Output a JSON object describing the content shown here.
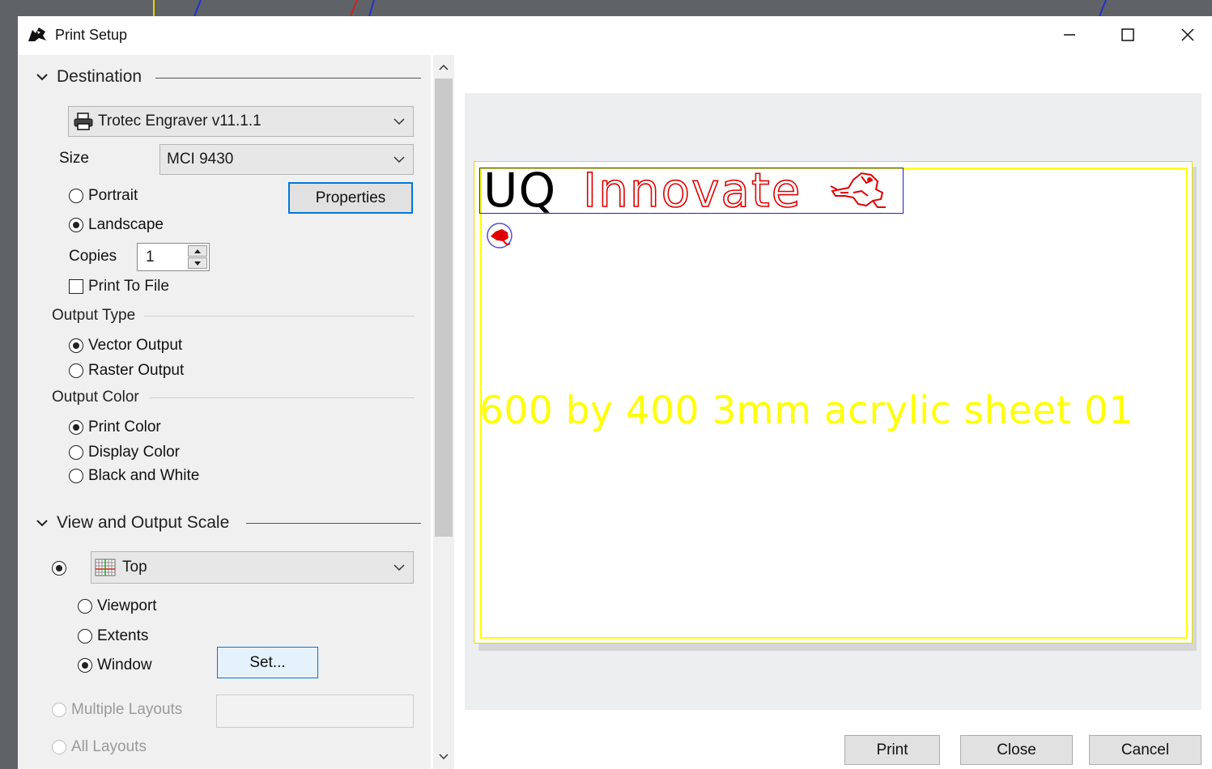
{
  "window": {
    "title": "Print Setup"
  },
  "destination": {
    "heading": "Destination",
    "printer": "Trotec Engraver v11.1.1",
    "size_label": "Size",
    "size_value": "MCI 9430",
    "orientation_portrait": "Portrait",
    "orientation_landscape": "Landscape",
    "selected_orientation": "Landscape",
    "properties_button": "Properties",
    "copies_label": "Copies",
    "copies_value": "1",
    "print_to_file": "Print To File",
    "print_to_file_checked": false
  },
  "output_type": {
    "heading": "Output Type",
    "vector": "Vector Output",
    "raster": "Raster Output",
    "selected": "Vector Output"
  },
  "output_color": {
    "heading": "Output Color",
    "print_color": "Print Color",
    "display_color": "Display Color",
    "black_white": "Black and White",
    "selected": "Print Color"
  },
  "view_scale": {
    "heading": "View and Output Scale",
    "view_value": "Top",
    "viewport": "Viewport",
    "extents": "Extents",
    "window": "Window",
    "selected_area": "Window",
    "set_button": "Set...",
    "multiple_layouts": "Multiple Layouts",
    "all_layouts": "All Layouts"
  },
  "preview": {
    "logo_uq": "UQ",
    "logo_innovate": "Innovate",
    "sheet_text": "600 by 400 3mm acrylic sheet 01",
    "colors": {
      "black": "#000000",
      "red": "#e00000",
      "yellow": "#ffff00",
      "blue": "#2020d0"
    }
  },
  "footer": {
    "print": "Print",
    "close": "Close",
    "cancel": "Cancel"
  },
  "icons": [
    "rhino-app-icon",
    "minimize-icon",
    "maximize-icon",
    "close-icon",
    "chevron-down-icon",
    "printer-icon",
    "viewport-grid-icon",
    "spinner-up-icon",
    "spinner-down-icon",
    "scroll-up-icon",
    "scroll-down-icon",
    "frog-logo-icon"
  ]
}
